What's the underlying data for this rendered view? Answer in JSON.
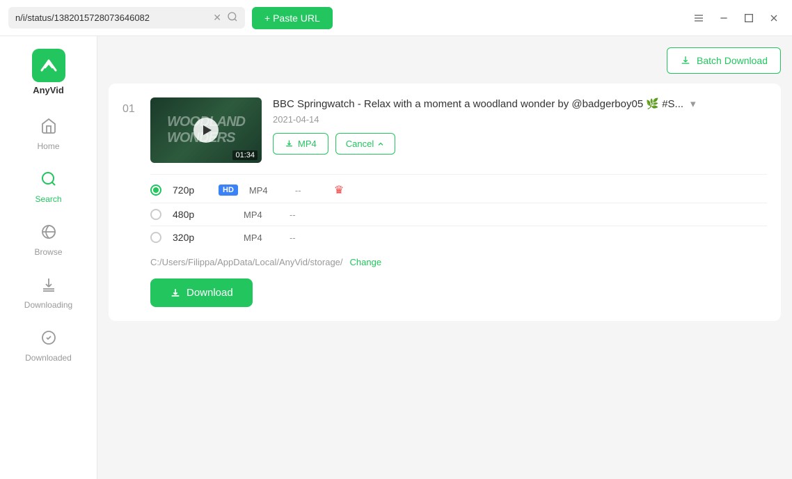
{
  "app": {
    "name": "AnyVid"
  },
  "titlebar": {
    "url_value": "n/i/status/1382015728073646082",
    "paste_btn_label": "+ Paste URL",
    "window_controls": [
      "menu",
      "minimize",
      "maximize",
      "close"
    ]
  },
  "sidebar": {
    "items": [
      {
        "id": "home",
        "label": "Home",
        "icon": "home"
      },
      {
        "id": "search",
        "label": "Search",
        "icon": "search",
        "active": true
      },
      {
        "id": "browse",
        "label": "Browse",
        "icon": "browse"
      },
      {
        "id": "downloading",
        "label": "Downloading",
        "icon": "downloading"
      },
      {
        "id": "downloaded",
        "label": "Downloaded",
        "icon": "downloaded"
      }
    ]
  },
  "content": {
    "batch_download_label": "Batch Download",
    "video": {
      "index": "01",
      "title": "BBC Springwatch - Relax with a moment a woodland wonder by @badgerboy05 🌿 #S...",
      "date": "2021-04-14",
      "duration": "01:34",
      "qualities": [
        {
          "resolution": "720p",
          "badge": "HD",
          "format": "MP4",
          "size": "--",
          "selected": true,
          "premium": true
        },
        {
          "resolution": "480p",
          "badge": "",
          "format": "MP4",
          "size": "--",
          "selected": false,
          "premium": false
        },
        {
          "resolution": "320p",
          "badge": "",
          "format": "MP4",
          "size": "--",
          "selected": false,
          "premium": false
        }
      ],
      "storage_path": "C:/Users/Filippa/AppData/Local/AnyVid/storage/",
      "change_label": "Change",
      "mp4_btn_label": "MP4",
      "cancel_btn_label": "Cancel",
      "download_btn_label": "Download"
    }
  }
}
